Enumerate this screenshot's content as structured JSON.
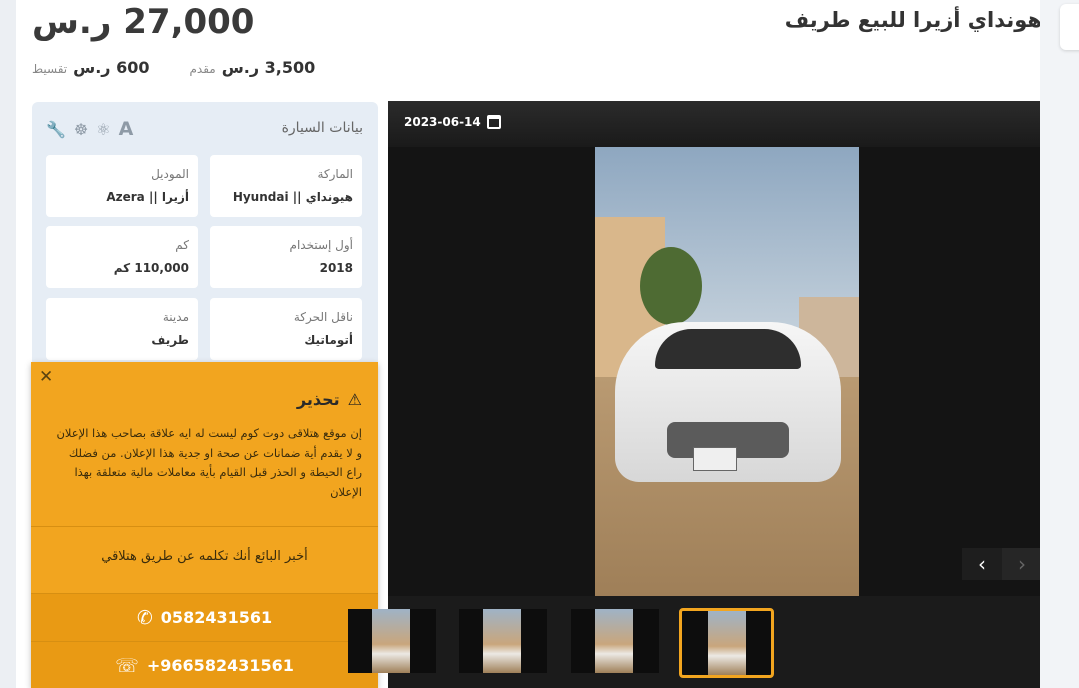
{
  "listing": {
    "price": "27,000 ر.س",
    "title": "هونداي أزيرا للبيع طريف",
    "installment_label": "تقسيط",
    "installment_value": "600 ر.س",
    "down_label": "مقدم",
    "down_value": "3,500 ر.س"
  },
  "specs": {
    "heading": "بيانات السيارة",
    "items": [
      {
        "label": "الماركة",
        "value": "هيونداي || Hyundai"
      },
      {
        "label": "الموديل",
        "value": "أزيرا || Azera"
      },
      {
        "label": "أول إستخدام",
        "value": "2018"
      },
      {
        "label": "كم",
        "value": "110,000 كم"
      },
      {
        "label": "ناقل الحركة",
        "value": "أتوماتيك"
      },
      {
        "label": "مدينة",
        "value": "طريف"
      }
    ],
    "tools": [
      "wrench-icon",
      "steering-wheel-icon",
      "engine-icon",
      "font-a-icon"
    ]
  },
  "warning": {
    "close": "✕",
    "title": "تحذير",
    "body": "إن موقع هتلاقى دوت كوم ليست له ايه علاقة بصاحب هذا الإعلان و لا يقدم أية ضمانات عن صحة او جدية هذا الإعلان. من فضلك راع الحيطة و الحذر قبل القيام بأية معاملات مالية متعلقة بهذا الإعلان",
    "tell_seller": "أخبر البائع أنك تكلمه عن طريق هتلاقي",
    "phone": "0582431561",
    "whatsapp": "+966582431561"
  },
  "gallery": {
    "date": "2023-06-14",
    "thumb_count": 4,
    "active_thumb": 4
  },
  "colors": {
    "accent": "#f2a51f",
    "panel": "#e6edf5"
  }
}
